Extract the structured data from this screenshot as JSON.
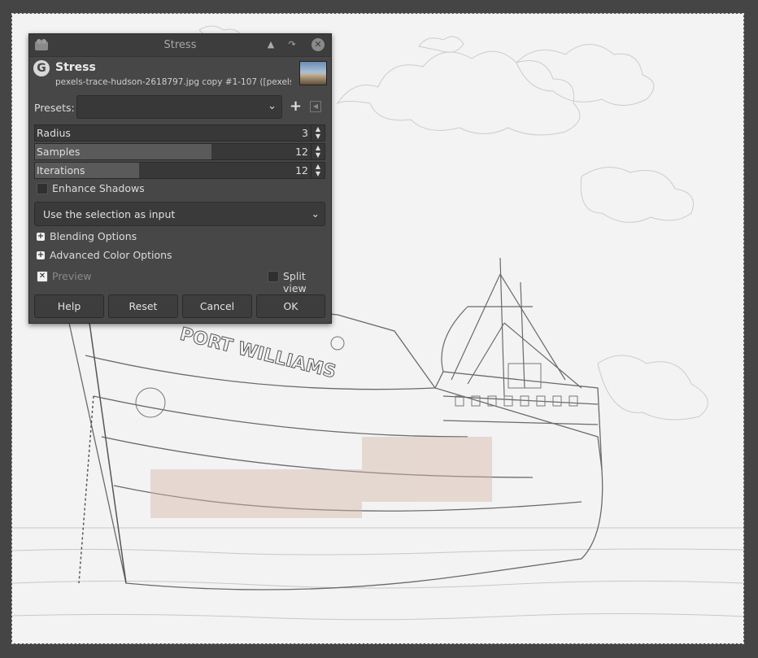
{
  "dialog": {
    "window_title": "Stress",
    "filter_name": "Stress",
    "image_subtitle": "pexels-trace-hudson-2618797.jpg copy #1-107 ([pexels-trac...",
    "logo_letter": "G",
    "presets_label": "Presets:",
    "presets_value": "",
    "add_preset_symbol": "+",
    "params": [
      {
        "label": "Radius",
        "value": "3",
        "fill_fraction": 0.0
      },
      {
        "label": "Samples",
        "value": "12",
        "fill_fraction": 0.61
      },
      {
        "label": "Iterations",
        "value": "12",
        "fill_fraction": 0.36
      }
    ],
    "enhance_shadows_label": "Enhance Shadows",
    "enhance_shadows_checked": false,
    "input_mode": "Use the selection as input",
    "blending_options_label": "Blending Options",
    "advanced_color_label": "Advanced Color Options",
    "preview_label": "Preview",
    "preview_checked": true,
    "split_view_label": "Split view",
    "split_view_checked": false,
    "buttons": {
      "help": "Help",
      "reset": "Reset",
      "cancel": "Cancel",
      "ok": "OK"
    }
  },
  "canvas": {
    "ship_lettering": "PORT WILLIAMS"
  }
}
